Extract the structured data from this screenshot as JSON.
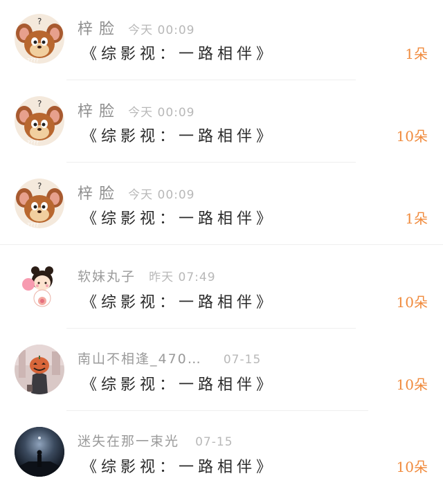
{
  "rows": [
    {
      "name": "梓 脸",
      "time": "今天 00:09",
      "message": "《综影视：一路相伴》",
      "count": "1朵",
      "avatar": "jerry-mouse-avatar"
    },
    {
      "name": "梓 脸",
      "time": "今天 00:09",
      "message": "《综影视：一路相伴》",
      "count": "10朵",
      "avatar": "jerry-mouse-avatar"
    },
    {
      "name": "梓 脸",
      "time": "今天 00:09",
      "message": "《综影视：一路相伴》",
      "count": "1朵",
      "avatar": "jerry-mouse-avatar"
    },
    {
      "name": "软妹丸子",
      "time": "昨天 07:49",
      "message": "《综影视：一路相伴》",
      "count": "10朵",
      "avatar": "cartoon-girl-avatar"
    },
    {
      "name": "南山不相逢_470…",
      "time": "07-15",
      "message": "《综影视：一路相伴》",
      "count": "10朵",
      "avatar": "pumpkin-head-avatar"
    },
    {
      "name": "迷失在那一束光",
      "time": "07-15",
      "message": "《综影视：一路相伴》",
      "count": "10朵",
      "avatar": "night-figure-avatar"
    }
  ],
  "colors": {
    "accent_count": "#f08a3c",
    "name_gray": "#8e8e8e",
    "time_gray": "#b8b8b8",
    "divider": "#efefef"
  }
}
